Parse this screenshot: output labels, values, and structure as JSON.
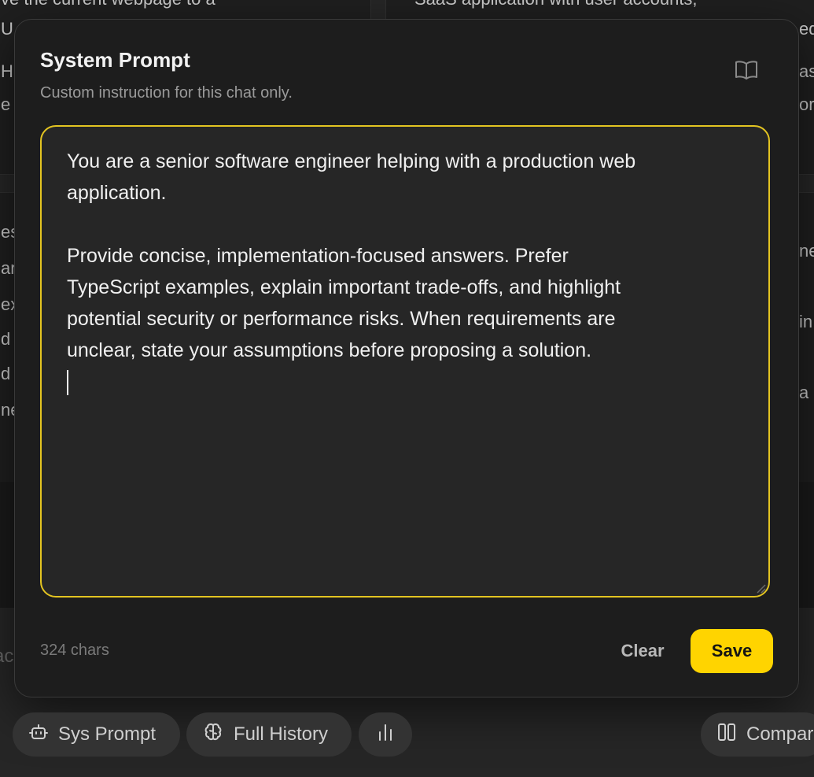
{
  "background": {
    "left_card_fragments": [
      "ve the current webpage to a",
      "U",
      "H",
      "e"
    ],
    "right_card_fragments": [
      "SaaS application with user accounts,",
      "ed",
      "as",
      "or"
    ],
    "left_card2_fragments": [
      "es",
      "ar",
      "ex",
      "d",
      "d",
      "ne"
    ],
    "right_card2_fragments": [
      "ne",
      "in",
      "a"
    ],
    "input_hint": "ac"
  },
  "modal": {
    "title": "System Prompt",
    "subtitle": "Custom instruction for this chat only.",
    "book_icon": "book-open-icon",
    "prompt_text": "You are a senior software engineer helping with a production web\napplication.\n\nProvide concise, implementation-focused answers. Prefer\nTypeScript examples, explain important trade-offs, and highlight\npotential security or performance risks. When requirements are\nunclear, state your assumptions before proposing a solution.\n",
    "char_count": "324 chars",
    "clear_label": "Clear",
    "save_label": "Save",
    "accent_color": "#ffd400"
  },
  "toolbar": {
    "sys_prompt_label": "Sys Prompt",
    "sys_prompt_icon": "bot-icon",
    "full_history_label": "Full History",
    "full_history_icon": "brain-icon",
    "stats_icon": "bar-chart-icon",
    "compare_label": "Compar",
    "compare_icon": "columns-icon"
  }
}
